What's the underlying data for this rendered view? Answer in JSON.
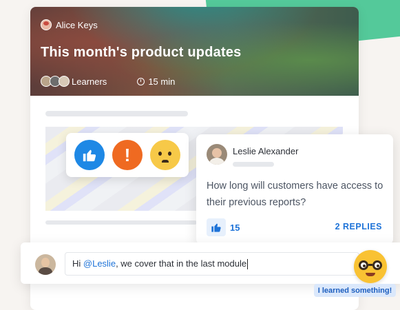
{
  "post": {
    "author": "Alice Keys",
    "title": "This month's product updates",
    "learners_label": "Learners",
    "duration": "15 min"
  },
  "reactions": [
    "thumbs-up-icon",
    "alert-icon",
    "worried-emoji-icon"
  ],
  "comment": {
    "author": "Leslie Alexander",
    "text": "How long will customers have access to their previous reports?",
    "likes": "15",
    "replies_label": "2 REPLIES"
  },
  "reply": {
    "prefix": "Hi ",
    "mention": "@Leslie",
    "suffix": ", we cover that in the last module"
  },
  "badge": {
    "label": "I learned something!"
  },
  "colors": {
    "accent_blue": "#1e73d8",
    "alert_orange": "#ef6a21",
    "emoji_yellow": "#f7c948",
    "background_green": "#54c99a"
  }
}
